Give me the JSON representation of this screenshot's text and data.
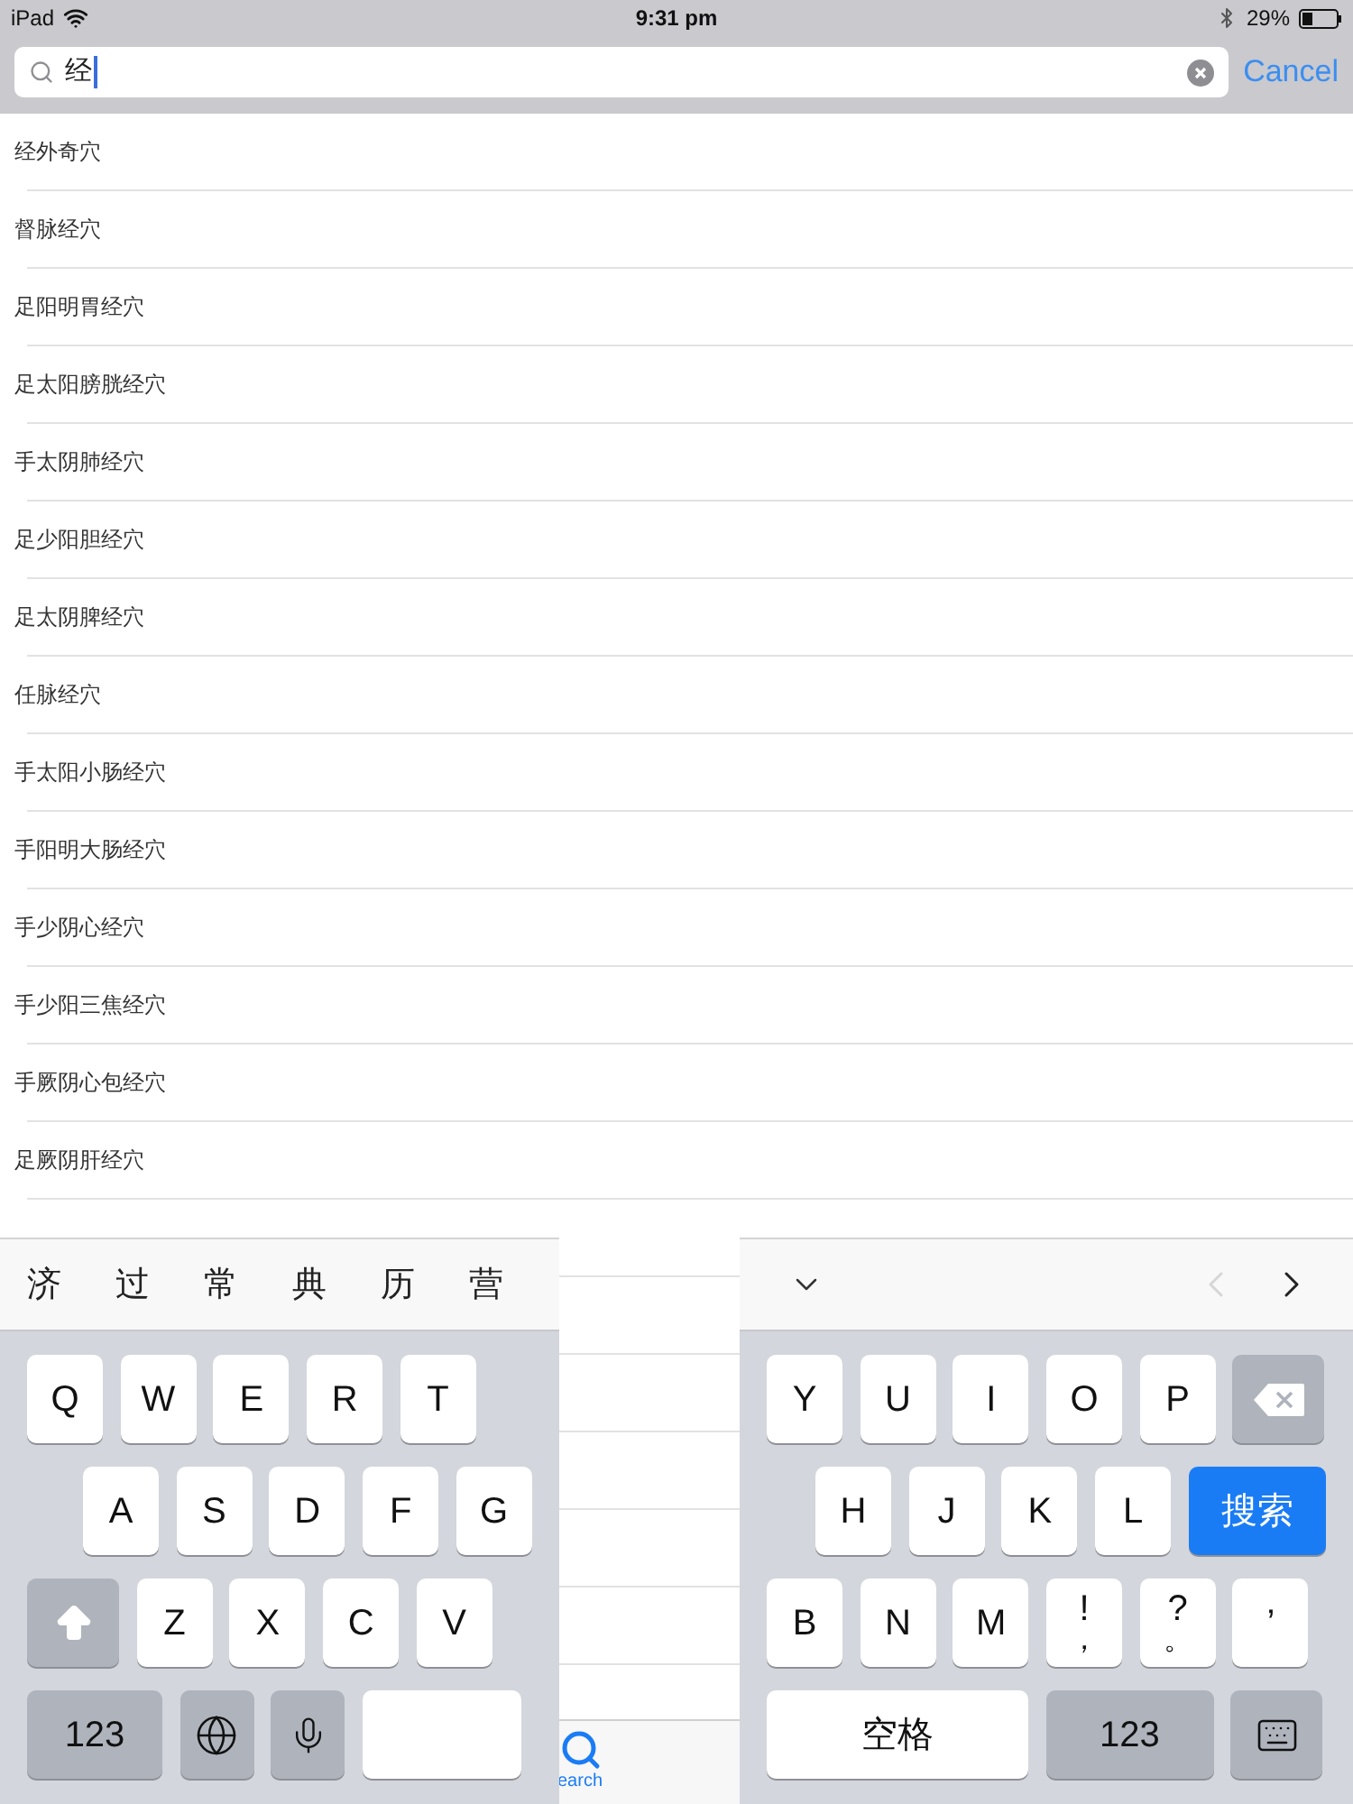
{
  "status_bar": {
    "device": "iPad",
    "time": "9:31 pm",
    "battery": "29%"
  },
  "search": {
    "value": "经",
    "cancel": "Cancel"
  },
  "results": [
    {
      "label": "经外奇穴"
    },
    {
      "label": "督脉经穴"
    },
    {
      "label": "足阳明胃经穴"
    },
    {
      "label": "足太阳膀胱经穴"
    },
    {
      "label": "手太阴肺经穴"
    },
    {
      "label": "足少阳胆经穴"
    },
    {
      "label": "足太阴脾经穴"
    },
    {
      "label": "任脉经穴"
    },
    {
      "label": "手太阳小肠经穴"
    },
    {
      "label": "手阳明大肠经穴"
    },
    {
      "label": "手少阴心经穴"
    },
    {
      "label": "手少阳三焦经穴"
    },
    {
      "label": "手厥阴心包经穴"
    },
    {
      "label": "足厥阴肝经穴"
    }
  ],
  "tab_bar": {
    "label": "earch",
    "selected": true
  },
  "keyboard": {
    "candidates": [
      "济",
      "过",
      "常",
      "典",
      "历",
      "营"
    ],
    "nav": {
      "back_disabled": true,
      "forward_disabled": false
    },
    "left_rows": [
      [
        {
          "kind": "letter",
          "label": "Q"
        },
        {
          "kind": "letter",
          "label": "W"
        },
        {
          "kind": "letter",
          "label": "E"
        },
        {
          "kind": "letter",
          "label": "R"
        },
        {
          "kind": "letter",
          "label": "T"
        }
      ],
      [
        {
          "kind": "letter",
          "label": "A"
        },
        {
          "kind": "letter",
          "label": "S"
        },
        {
          "kind": "letter",
          "label": "D"
        },
        {
          "kind": "letter",
          "label": "F"
        },
        {
          "kind": "letter",
          "label": "G"
        }
      ],
      [
        {
          "kind": "shift"
        },
        {
          "kind": "letter",
          "label": "Z"
        },
        {
          "kind": "letter",
          "label": "X"
        },
        {
          "kind": "letter",
          "label": "C"
        },
        {
          "kind": "letter",
          "label": "V"
        }
      ],
      [
        {
          "kind": "numbers",
          "label": "123"
        },
        {
          "kind": "globe"
        },
        {
          "kind": "mic"
        },
        {
          "kind": "space"
        }
      ]
    ],
    "right_rows": [
      [
        {
          "kind": "letter",
          "label": "Y"
        },
        {
          "kind": "letter",
          "label": "U"
        },
        {
          "kind": "letter",
          "label": "I"
        },
        {
          "kind": "letter",
          "label": "O"
        },
        {
          "kind": "letter",
          "label": "P"
        },
        {
          "kind": "delete"
        }
      ],
      [
        {
          "kind": "letter",
          "label": "H"
        },
        {
          "kind": "letter",
          "label": "J"
        },
        {
          "kind": "letter",
          "label": "K"
        },
        {
          "kind": "letter",
          "label": "L"
        },
        {
          "kind": "action",
          "label": "搜索"
        }
      ],
      [
        {
          "kind": "letter",
          "label": "B"
        },
        {
          "kind": "letter",
          "label": "N"
        },
        {
          "kind": "letter",
          "label": "M"
        },
        {
          "kind": "punct",
          "label": "!",
          "sublabel": "，"
        },
        {
          "kind": "punct",
          "label": "?",
          "sublabel": "。"
        },
        {
          "kind": "letter",
          "label": "’"
        }
      ],
      [
        {
          "kind": "space",
          "label": "空格"
        },
        {
          "kind": "numbers",
          "label": "123"
        },
        {
          "kind": "hide"
        }
      ]
    ]
  }
}
